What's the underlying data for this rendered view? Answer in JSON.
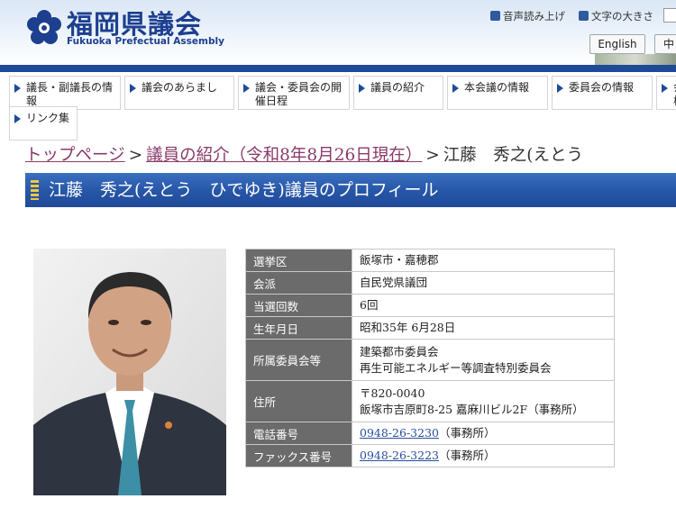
{
  "header": {
    "site_title": "福岡県議会",
    "site_subtitle": "Fukuoka Prefectual Assembly",
    "speech_link": "音声読み上げ",
    "text_size_link": "文字の大きさ",
    "lang_english": "English",
    "lang_chinese": "中"
  },
  "nav": {
    "items": [
      {
        "label": "議長・副議長の情報"
      },
      {
        "label": "議会のあらまし"
      },
      {
        "label": "議会・委員会の開催日程"
      },
      {
        "label": "議員の紹介"
      },
      {
        "label": "本会議の情報"
      },
      {
        "label": "委員会の情報"
      },
      {
        "label": "会検"
      },
      {
        "label": "リンク集"
      }
    ]
  },
  "breadcrumb": {
    "top": "トップページ",
    "members": "議員の紹介（令和8年8月26日現在）",
    "current": "江藤　秀之(えとう",
    "sep": ">"
  },
  "page": {
    "title": "江藤　秀之(えとう　ひでゆき)議員のプロフィール"
  },
  "profile": {
    "rows": [
      {
        "label": "選挙区",
        "value": "飯塚市・嘉穂郡"
      },
      {
        "label": "会派",
        "value": "自民党県議団"
      },
      {
        "label": "当選回数",
        "value": "6回"
      },
      {
        "label": "生年月日",
        "value": "昭和35年 6月28日"
      },
      {
        "label": "所属委員会等",
        "line1": "建築都市委員会",
        "line2": "再生可能エネルギー等調査特別委員会"
      },
      {
        "label": "住所",
        "line1": "〒820-0040",
        "line2": "飯塚市吉原町8-25 嘉麻川ビル2F（事務所）"
      },
      {
        "label": "電話番号",
        "link": "0948-26-3230",
        "note": "（事務所）"
      },
      {
        "label": "ファックス番号",
        "link": "0948-26-3223",
        "note": "（事務所）"
      }
    ]
  },
  "colors": {
    "brand_blue": "#1e4a9a",
    "title_bar": "#2857a8",
    "label_bg": "#6b6b6b",
    "visited_link": "#8a3a6a"
  }
}
